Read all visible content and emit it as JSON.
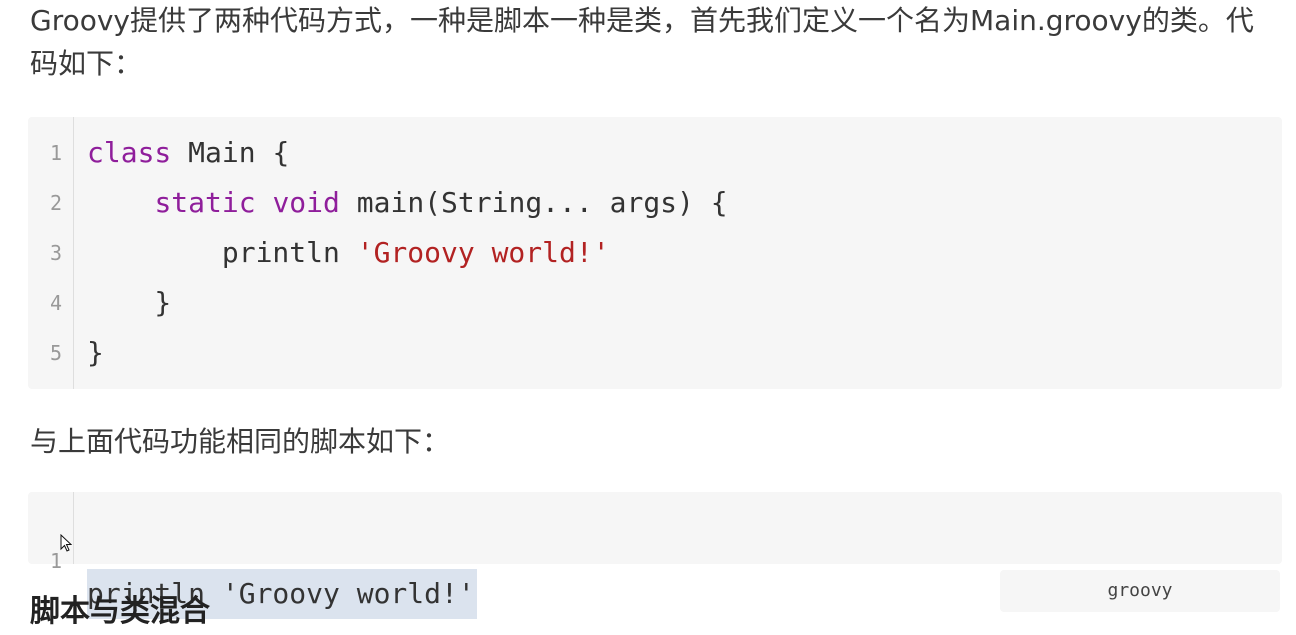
{
  "intro_paragraph": "Groovy提供了两种代码方式，一种是脚本一种是类，首先我们定义一个名为Main.groovy的类。代码如下：",
  "class_code": {
    "lines": [
      {
        "number": "1",
        "parts": [
          {
            "type": "keyword",
            "text": "class"
          },
          {
            "type": "plain",
            "text": " Main {"
          }
        ]
      },
      {
        "number": "2",
        "parts": [
          {
            "type": "plain",
            "text": "    "
          },
          {
            "type": "keyword",
            "text": "static"
          },
          {
            "type": "plain",
            "text": " "
          },
          {
            "type": "keyword",
            "text": "void"
          },
          {
            "type": "plain",
            "text": " main(String... args) {"
          }
        ]
      },
      {
        "number": "3",
        "parts": [
          {
            "type": "plain",
            "text": "        println "
          },
          {
            "type": "string",
            "text": "'Groovy world!'"
          }
        ]
      },
      {
        "number": "4",
        "parts": [
          {
            "type": "plain",
            "text": "    }"
          }
        ]
      },
      {
        "number": "5",
        "parts": [
          {
            "type": "plain",
            "text": "}"
          }
        ]
      }
    ]
  },
  "script_paragraph": "与上面代码功能相同的脚本如下：",
  "script_code": {
    "line_number": "1",
    "selected_text": "println 'Groovy world!'"
  },
  "language_label": "groovy",
  "next_heading": "脚本与类混合",
  "colors": {
    "keyword": "#8f1e9b",
    "string": "#b22222",
    "code_background": "#f6f6f6",
    "selection": "#dbe3ee"
  },
  "icons": {
    "cursor": "mouse-pointer-icon"
  }
}
